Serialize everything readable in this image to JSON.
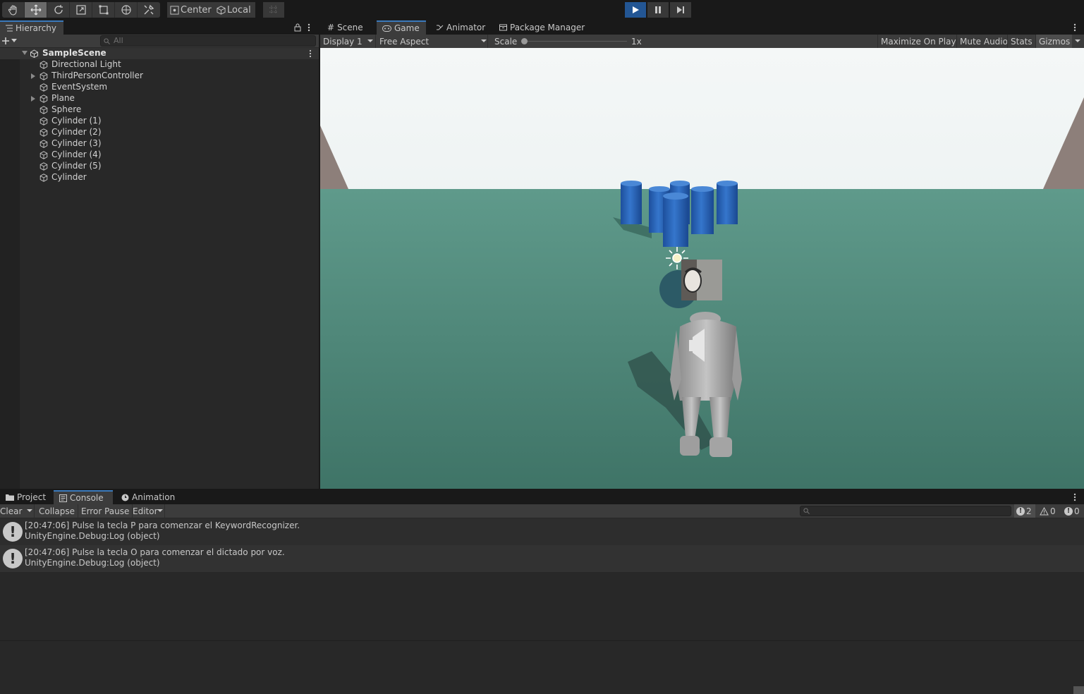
{
  "toolbar": {
    "pivot_center": "Center",
    "pivot_local": "Local"
  },
  "hierarchy": {
    "tab": "Hierarchy",
    "search_placeholder": "All",
    "scene": "SampleScene",
    "items": [
      {
        "label": "Directional Light",
        "expandable": false
      },
      {
        "label": "ThirdPersonController",
        "expandable": true
      },
      {
        "label": "EventSystem",
        "expandable": false
      },
      {
        "label": "Plane",
        "expandable": true
      },
      {
        "label": "Sphere",
        "expandable": false
      },
      {
        "label": "Cylinder (1)",
        "expandable": false
      },
      {
        "label": "Cylinder (2)",
        "expandable": false
      },
      {
        "label": "Cylinder (3)",
        "expandable": false
      },
      {
        "label": "Cylinder (4)",
        "expandable": false
      },
      {
        "label": "Cylinder (5)",
        "expandable": false
      },
      {
        "label": "Cylinder",
        "expandable": false
      }
    ]
  },
  "game_tabs": {
    "scene": "Scene",
    "game": "Game",
    "animator": "Animator",
    "package_manager": "Package Manager"
  },
  "game_bar": {
    "display": "Display 1",
    "aspect": "Free Aspect",
    "scale_label": "Scale",
    "scale_value": "1x",
    "maximize": "Maximize On Play",
    "mute": "Mute Audio",
    "stats": "Stats",
    "gizmos": "Gizmos"
  },
  "bottom_tabs": {
    "project": "Project",
    "console": "Console",
    "animation": "Animation"
  },
  "console_bar": {
    "clear": "Clear",
    "collapse": "Collapse",
    "error_pause": "Error Pause",
    "editor": "Editor",
    "log_count": "2",
    "warn_count": "0",
    "error_count": "0"
  },
  "logs": [
    {
      "line1": "[20:47:06] Pulse la tecla P para comenzar el KeywordRecognizer.",
      "line2": "UnityEngine.Debug:Log (object)"
    },
    {
      "line1": "[20:47:06] Pulse la tecla O para comenzar el dictado por voz.",
      "line2": "UnityEngine.Debug:Log (object)"
    }
  ],
  "colors": {
    "accent": "#3a79bb",
    "play_active": "#235694",
    "ground": "#4f8a7c",
    "cylinder": "#2a63b8"
  }
}
